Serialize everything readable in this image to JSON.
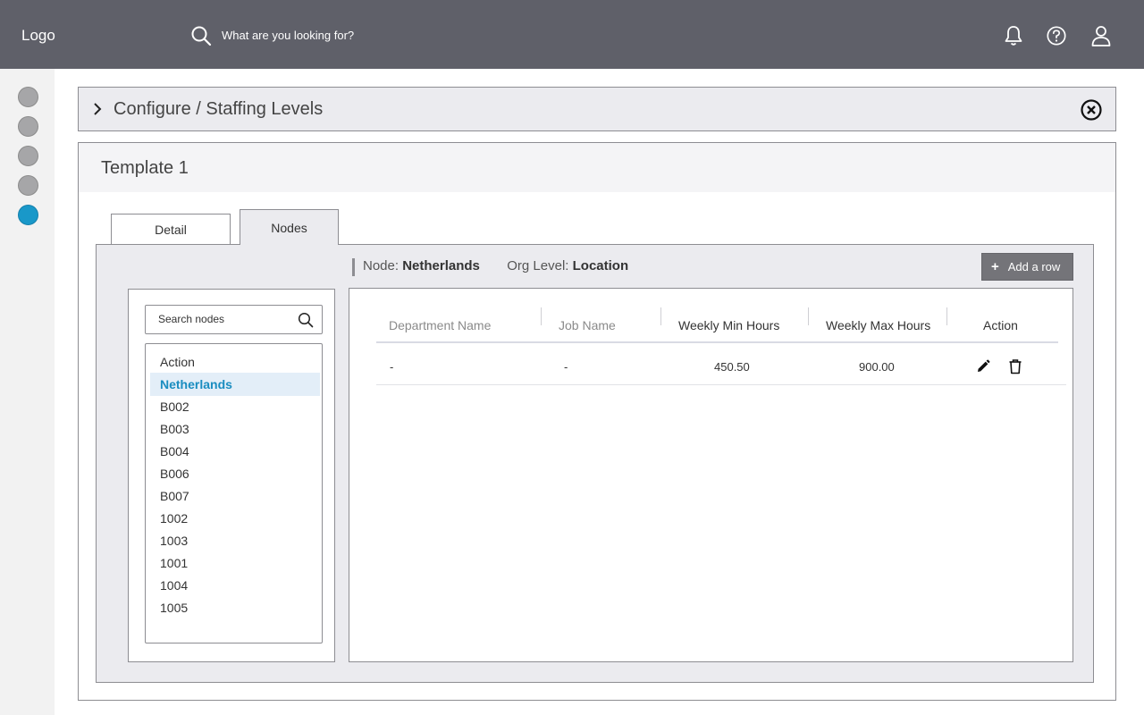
{
  "header": {
    "logo": "Logo",
    "search_placeholder": "What are you looking for?",
    "icons": [
      "bell-icon",
      "help-icon",
      "user-icon"
    ]
  },
  "sidebar": {
    "items": [
      {
        "id": 1,
        "active": false
      },
      {
        "id": 2,
        "active": false
      },
      {
        "id": 3,
        "active": false
      },
      {
        "id": 4,
        "active": false
      },
      {
        "id": 5,
        "active": true
      }
    ]
  },
  "breadcrumb": {
    "text": "Configure / Staffing Levels"
  },
  "card": {
    "title": "Template 1"
  },
  "tabs": [
    {
      "label": "Detail",
      "active": false
    },
    {
      "label": "Nodes",
      "active": true
    }
  ],
  "node_info": {
    "node_label": "Node:",
    "node_value": "Netherlands",
    "org_label": "Org Level:",
    "org_value": "Location"
  },
  "add_row_label": "Add a row",
  "node_search": {
    "placeholder": "Search nodes"
  },
  "node_list": {
    "items": [
      "Action",
      "Netherlands",
      "B002",
      "B003",
      "B004",
      "B006",
      "B007",
      "1002",
      "1003",
      "1001",
      "1004",
      "1005"
    ],
    "selected": "Netherlands"
  },
  "table": {
    "columns": [
      "Department Name",
      "Job Name",
      "Weekly Min Hours",
      "Weekly Max Hours",
      "Action"
    ],
    "rows": [
      {
        "department": "-",
        "job": "-",
        "min_hours": "450.50",
        "max_hours": "900.00"
      }
    ]
  },
  "colors": {
    "topbar": "#5f6069",
    "accent": "#1998c9",
    "panel": "#ebebef"
  }
}
